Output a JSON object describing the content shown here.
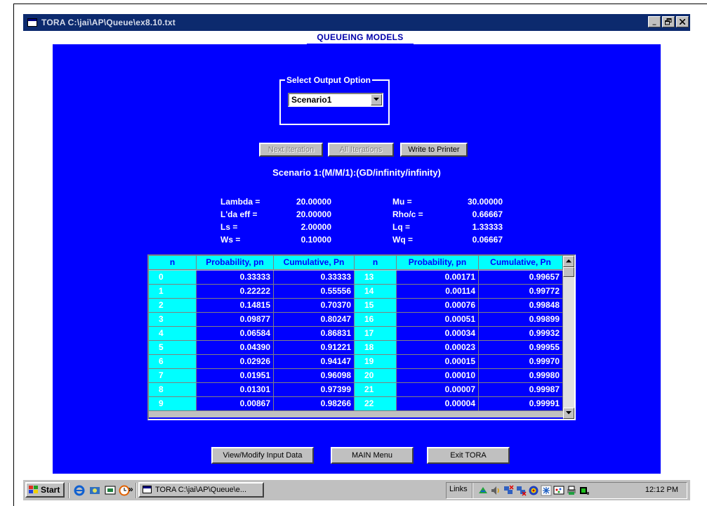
{
  "window": {
    "title": "TORA  C:\\jai\\AP\\Queue\\ex8.10.txt",
    "controls": [
      "_",
      "̅□",
      "x"
    ]
  },
  "header": {
    "title": "QUEUEING MODELS"
  },
  "output_option": {
    "legend": "Select Output Option",
    "selected": "Scenario1"
  },
  "buttons": {
    "next_iteration": "Next Iteration",
    "all_iterations": "All Iterations",
    "write_to_printer": "Write to Printer",
    "view_modify": "View/Modify Input Data",
    "main_menu": "MAIN Menu",
    "exit": "Exit TORA"
  },
  "scenario": {
    "title": "Scenario  1:(M/M/1):(GD/infinity/infinity)",
    "stats": [
      {
        "label": "Lambda =",
        "value": "20.00000"
      },
      {
        "label": "L'da eff =",
        "value": "20.00000"
      },
      {
        "label": "Ls =",
        "value": "2.00000"
      },
      {
        "label": "Ws =",
        "value": "0.10000"
      },
      {
        "label": "Mu =",
        "value": "30.00000"
      },
      {
        "label": "Rho/c =",
        "value": "0.66667"
      },
      {
        "label": "Lq =",
        "value": "1.33333"
      },
      {
        "label": "Wq =",
        "value": "0.06667"
      }
    ]
  },
  "table": {
    "headers": [
      "n",
      "Probability, pn",
      "Cumulative, Pn",
      "n",
      "Probability, pn",
      "Cumulative, Pn"
    ],
    "left_rows": [
      {
        "n": "0",
        "p": "0.33333",
        "c": "0.33333"
      },
      {
        "n": "1",
        "p": "0.22222",
        "c": "0.55556"
      },
      {
        "n": "2",
        "p": "0.14815",
        "c": "0.70370"
      },
      {
        "n": "3",
        "p": "0.09877",
        "c": "0.80247"
      },
      {
        "n": "4",
        "p": "0.06584",
        "c": "0.86831"
      },
      {
        "n": "5",
        "p": "0.04390",
        "c": "0.91221"
      },
      {
        "n": "6",
        "p": "0.02926",
        "c": "0.94147"
      },
      {
        "n": "7",
        "p": "0.01951",
        "c": "0.96098"
      },
      {
        "n": "8",
        "p": "0.01301",
        "c": "0.97399"
      },
      {
        "n": "9",
        "p": "0.00867",
        "c": "0.98266"
      }
    ],
    "right_rows": [
      {
        "n": "13",
        "p": "0.00171",
        "c": "0.99657"
      },
      {
        "n": "14",
        "p": "0.00114",
        "c": "0.99772"
      },
      {
        "n": "15",
        "p": "0.00076",
        "c": "0.99848"
      },
      {
        "n": "16",
        "p": "0.00051",
        "c": "0.99899"
      },
      {
        "n": "17",
        "p": "0.00034",
        "c": "0.99932"
      },
      {
        "n": "18",
        "p": "0.00023",
        "c": "0.99955"
      },
      {
        "n": "19",
        "p": "0.00015",
        "c": "0.99970"
      },
      {
        "n": "20",
        "p": "0.00010",
        "c": "0.99980"
      },
      {
        "n": "21",
        "p": "0.00007",
        "c": "0.99987"
      },
      {
        "n": "22",
        "p": "0.00004",
        "c": "0.99991"
      }
    ]
  },
  "taskbar": {
    "start": "Start",
    "chevron": "»",
    "task_label": "TORA  C:\\jai\\AP\\Queue\\e...",
    "links": "Links",
    "clock": "12:12 PM"
  },
  "colors": {
    "panel": "#0000ff",
    "header_cell": "#00ffff",
    "title_bar": "#0c2a6e",
    "taskbar": "#c0c0c0"
  }
}
